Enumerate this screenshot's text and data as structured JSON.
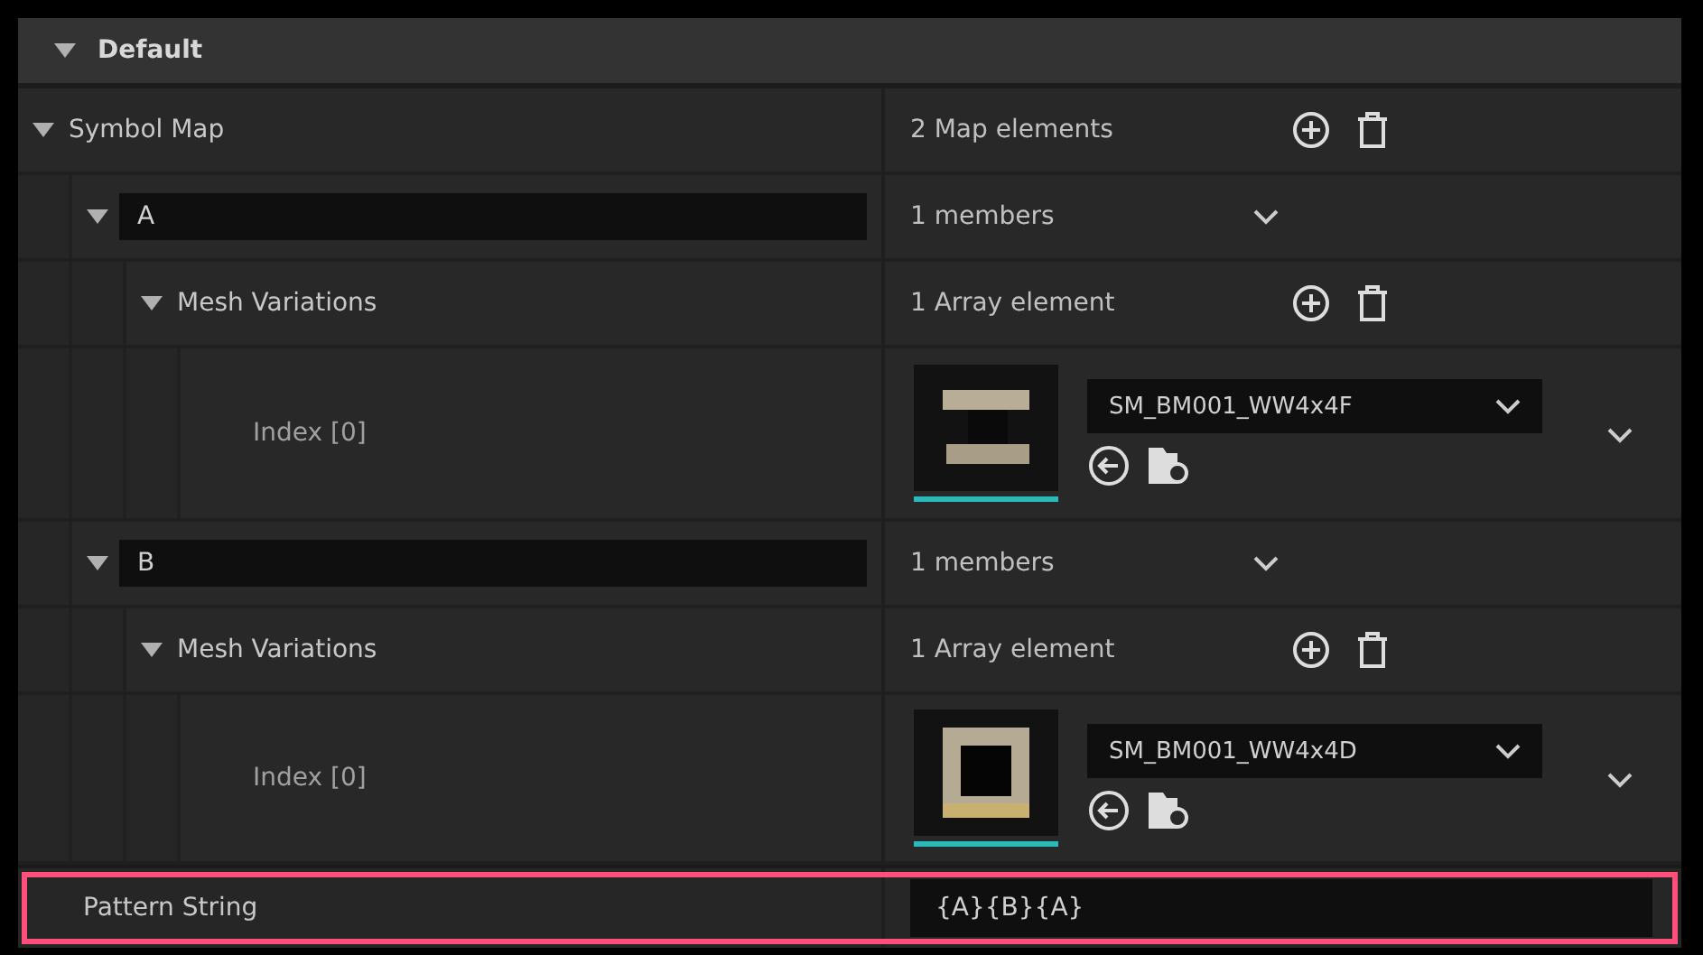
{
  "section": {
    "title": "Default",
    "expanded": true
  },
  "symbol_map": {
    "label": "Symbol Map",
    "expanded": true,
    "summary": "2 Map elements",
    "entries": [
      {
        "key": "A",
        "expanded": true,
        "members": "1 members",
        "variations": {
          "label": "Mesh Variations",
          "expanded": true,
          "summary": "1 Array element",
          "items": [
            {
              "label": "Index [0]",
              "mesh": "SM_BM001_WW4x4F",
              "kind": "bars"
            }
          ]
        }
      },
      {
        "key": "B",
        "expanded": true,
        "members": "1 members",
        "variations": {
          "label": "Mesh Variations",
          "expanded": true,
          "summary": "1 Array element",
          "items": [
            {
              "label": "Index [0]",
              "mesh": "SM_BM001_WW4x4D",
              "kind": "frame"
            }
          ]
        }
      }
    ]
  },
  "pattern": {
    "label": "Pattern String",
    "value": "{A}{B}{A}",
    "highlighted": true
  }
}
